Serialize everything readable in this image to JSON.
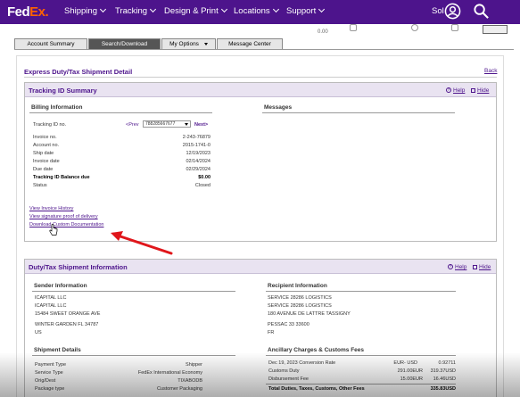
{
  "nav": {
    "logo_fed": "Fed",
    "logo_ex": "Ex",
    "logo_dot": ".",
    "items": [
      "Shipping",
      "Tracking",
      "Design & Print",
      "Locations",
      "Support"
    ],
    "user_label": "Sol"
  },
  "substrip": {
    "left_value": "0.00",
    "print_label": ""
  },
  "tabs": [
    "Account Summary",
    "Search/Download",
    "My Options",
    "Message Center"
  ],
  "page": {
    "title": "Express Duty/Tax Shipment Detail",
    "back": "Back"
  },
  "tracking_summary": {
    "title": "Tracking ID Summary",
    "help": "Help",
    "hide": "Hide",
    "billing_heading": "Billing Information",
    "messages_heading": "Messages",
    "tracking_label": "Tracking ID no.",
    "prev": "<Prev",
    "tracking_value": "788285667677",
    "next": "Next>",
    "rows": [
      {
        "label": "Invoice no.",
        "value": "2-243-76879"
      },
      {
        "label": "Account no.",
        "value": "2015-1741-0"
      },
      {
        "label": "Ship date",
        "value": "12/19/2023"
      },
      {
        "label": "Invoice date",
        "value": "02/14/2024"
      },
      {
        "label": "Due date",
        "value": "02/29/2024"
      },
      {
        "label": "Tracking ID Balance due",
        "value": "$0.00"
      },
      {
        "label": "Status",
        "value": "Closed"
      }
    ],
    "links": [
      "View Invoice History",
      "View signature proof of delivery",
      "Download Custom Documentation"
    ]
  },
  "duty_tax": {
    "title": "Duty/Tax Shipment Information",
    "help": "Help",
    "hide": "Hide",
    "sender_heading": "Sender Information",
    "recipient_heading": "Recipient Information",
    "sender_lines": [
      "ICAPITAL LLC",
      "ICAPITAL LLC",
      "15484 SWEET ORANGE AVE",
      "WINTER GARDEN FL 34787",
      "US"
    ],
    "recipient_lines": [
      "SERVICE 28286 LOGISTICS",
      "SERVICE 28286 LOGISTICS",
      "180 AVENUE DE LATTRE TASSIGNY",
      "PESSAC 33 33600",
      "FR"
    ],
    "shipment_heading": "Shipment Details",
    "ancillary_heading": "Ancillary Charges & Customs Fees",
    "shipment_rows": [
      {
        "label": "Payment Type",
        "value": "Shipper"
      },
      {
        "label": "Service Type",
        "value": "FedEx International Economy"
      },
      {
        "label": "Orig/Dest",
        "value": "TIXABODB"
      },
      {
        "label": "Package type",
        "value": "Customer Packaging"
      }
    ],
    "ancillary_rows": [
      {
        "label": "Dec 19, 2023 Conversion Rate",
        "mid": "EUR- USD",
        "value": "0.92711"
      },
      {
        "label": "Customs Duty",
        "mid": "291.00EUR",
        "value": "319.37USD"
      },
      {
        "label": "Disbursement Fee",
        "mid": "15.00EUR",
        "value": "16.46USD"
      },
      {
        "label": "Total Duties, Taxes, Customs, Other Fees",
        "mid": "",
        "value": "335.83USD"
      }
    ]
  },
  "colors": {
    "brand_purple": "#4d148c",
    "brand_orange": "#ff6200",
    "arrow_red": "#e0161b"
  }
}
